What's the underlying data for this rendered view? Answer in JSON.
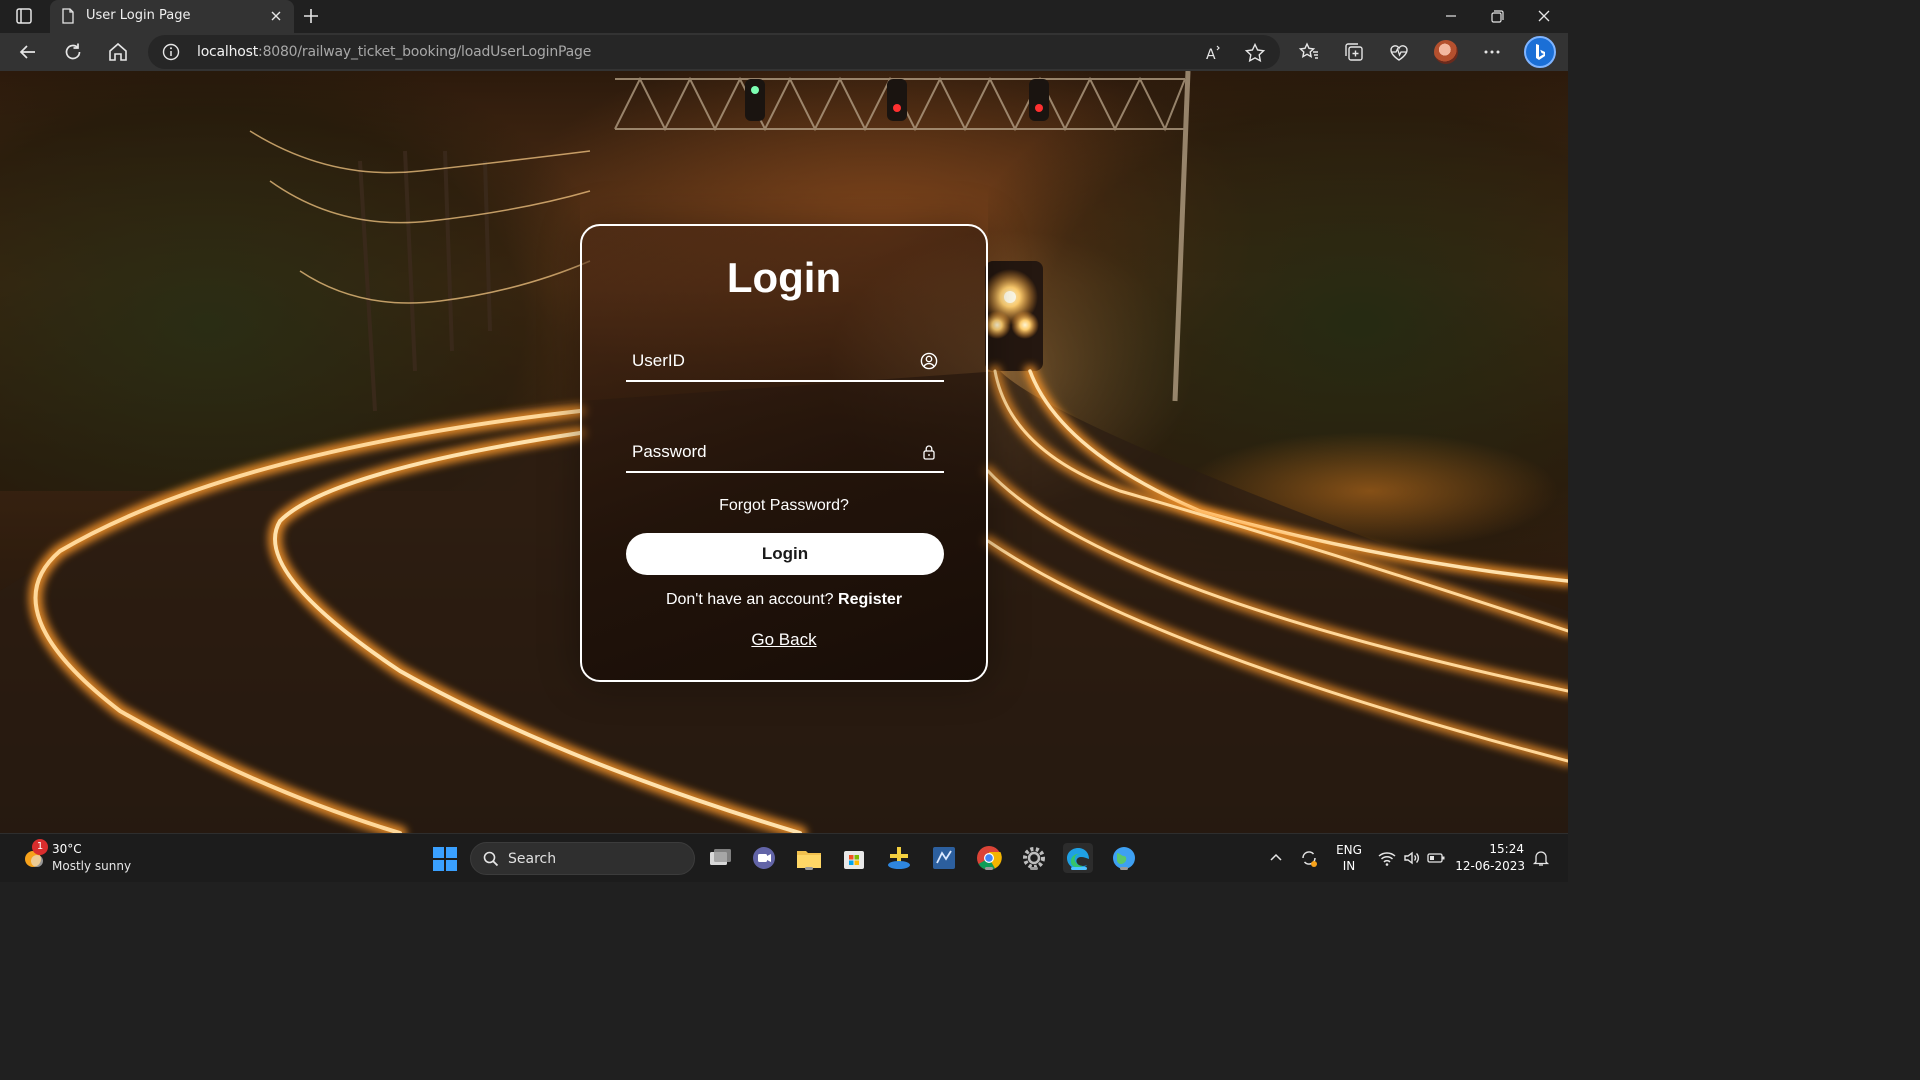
{
  "browser": {
    "tab": {
      "title": "User Login Page",
      "favicon": "page-icon"
    },
    "url": {
      "host": "localhost",
      "rest": ":8080/railway_ticket_booking/loadUserLoginPage"
    },
    "toolbar_icons": [
      "back-icon",
      "refresh-icon",
      "home-icon",
      "site-info-icon",
      "read-aloud-icon",
      "favorite-star-icon",
      "favorites-icon",
      "collections-icon",
      "browser-essentials-icon",
      "profile-avatar",
      "more-icon",
      "bing-copilot-icon"
    ],
    "window_controls": [
      "minimize-icon",
      "restore-icon",
      "close-icon"
    ]
  },
  "login": {
    "title": "Login",
    "userid_placeholder": "UserID",
    "password_placeholder": "Password",
    "forgot": "Forgot Password?",
    "button": "Login",
    "no_account": "Don't have an account?",
    "register": "Register",
    "go_back": "Go Back"
  },
  "taskbar": {
    "weather": {
      "temp": "30°C",
      "desc": "Mostly sunny",
      "badge": "1"
    },
    "search_placeholder": "Search",
    "apps": [
      "task-view-icon",
      "teams-chat-icon",
      "file-explorer-icon",
      "microsoft-store-icon",
      "game-app-icon",
      "code-editor-icon",
      "chrome-icon",
      "settings-icon",
      "edge-icon",
      "maps-app-icon"
    ],
    "tray": {
      "lang_top": "ENG",
      "lang_bottom": "IN",
      "time": "15:24",
      "date": "12-06-2023"
    }
  },
  "colors": {
    "accent": "#4cc2ff",
    "card_border": "#ffffff",
    "button_bg": "#ffffff",
    "rail_glow": "#ffb347"
  }
}
